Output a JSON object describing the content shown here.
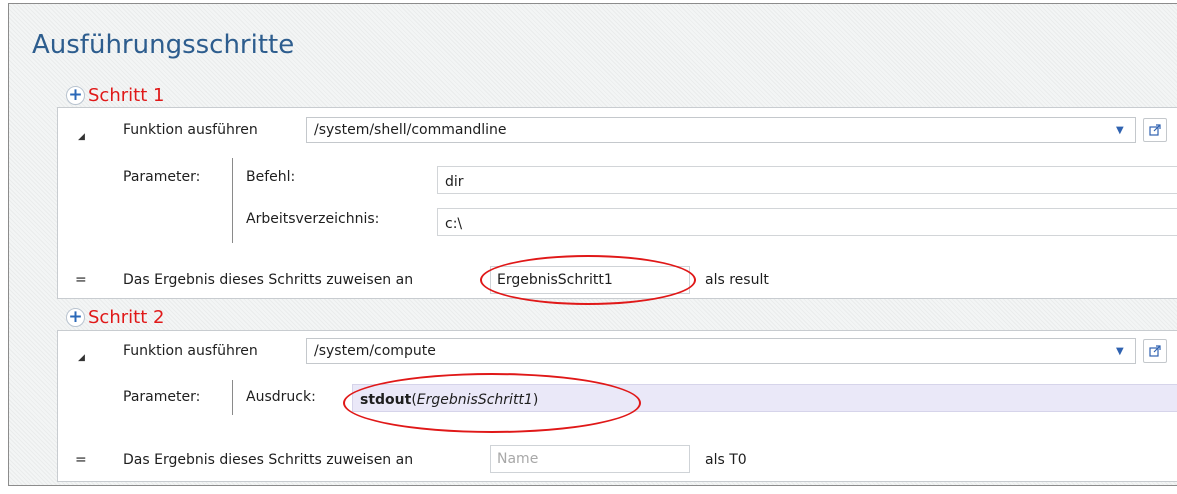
{
  "page": {
    "title": "Ausführungsschritte"
  },
  "steps": [
    {
      "label": "Schritt 1",
      "function_label": "Funktion ausführen",
      "function_value": "/system/shell/commandline",
      "params_label": "Parameter:",
      "params": [
        {
          "name": "Befehl:",
          "value": "dir"
        },
        {
          "name": "Arbeitsverzeichnis:",
          "value": "c:\\"
        }
      ],
      "eq_symbol": "=",
      "assign_label": "Das Ergebnis dieses Schritts zuweisen an",
      "assign_value": "ErgebnisSchritt1",
      "assign_placeholder": "",
      "as_label": "als result"
    },
    {
      "label": "Schritt 2",
      "function_label": "Funktion ausführen",
      "function_value": "/system/compute",
      "params_label": "Parameter:",
      "params": [
        {
          "name": "Ausdruck:",
          "value_func": "stdout",
          "value_open": "(",
          "value_arg": "ErgebnisSchritt1",
          "value_close": ")"
        }
      ],
      "eq_symbol": "=",
      "assign_label": "Das Ergebnis dieses Schritts zuweisen an",
      "assign_value": "",
      "assign_placeholder": "Name",
      "as_label": "als T0"
    }
  ],
  "colors": {
    "title": "#2d5d8e",
    "step_label": "#e01818",
    "highlight_oval": "#e01818",
    "expression_bg": "#eae8f8"
  },
  "icons": {
    "add": "plus-circle-icon",
    "collapse": "triangle-collapse-icon",
    "dropdown": "chevron-down-icon",
    "open_external": "open-external-icon"
  }
}
